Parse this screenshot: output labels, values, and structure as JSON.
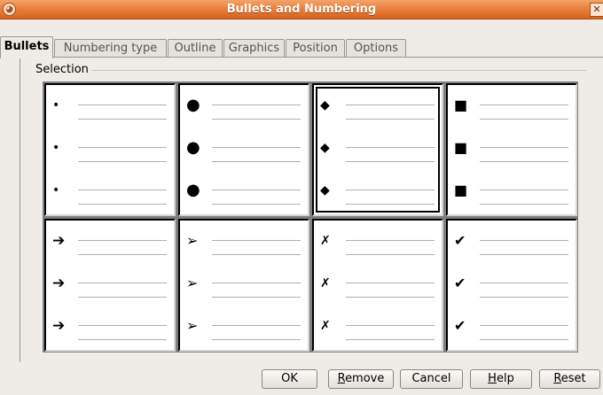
{
  "window": {
    "title": "Bullets and Numbering",
    "menu_glyph": "◕",
    "close_glyph": "✕"
  },
  "tabs": [
    {
      "label": "Bullets",
      "active": true
    },
    {
      "label": "Numbering type",
      "active": false
    },
    {
      "label": "Outline",
      "active": false
    },
    {
      "label": "Graphics",
      "active": false
    },
    {
      "label": "Position",
      "active": false
    },
    {
      "label": "Options",
      "active": false
    }
  ],
  "selection_label": "Selection",
  "bullet_styles": [
    {
      "icon": "small-dot-icon",
      "glyph": "•",
      "selected": false
    },
    {
      "icon": "large-dot-icon",
      "glyph": "●",
      "selected": false
    },
    {
      "icon": "diamond-icon",
      "glyph": "◆",
      "selected": true
    },
    {
      "icon": "square-icon",
      "glyph": "■",
      "selected": false
    },
    {
      "icon": "bold-arrow-icon",
      "glyph": "➔",
      "selected": false
    },
    {
      "icon": "arrowhead-icon",
      "glyph": "➢",
      "selected": false
    },
    {
      "icon": "cross-mark-icon",
      "glyph": "✗",
      "selected": false
    },
    {
      "icon": "check-mark-icon",
      "glyph": "✔",
      "selected": false
    }
  ],
  "buttons": {
    "ok": "OK",
    "remove": {
      "mnemonic": "R",
      "rest": "emove"
    },
    "cancel": "Cancel",
    "help": {
      "mnemonic": "H",
      "rest": "elp"
    },
    "reset": {
      "mnemonic": "R",
      "rest": "eset"
    }
  }
}
